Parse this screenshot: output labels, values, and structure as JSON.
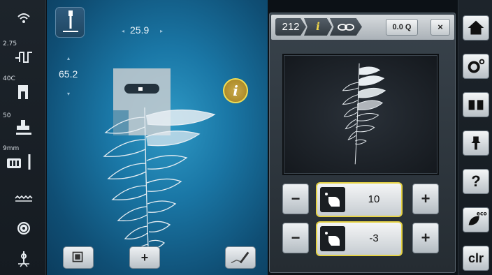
{
  "left_bar": {
    "items": [
      {
        "icon": "wifi-icon",
        "label": ""
      },
      {
        "icon": "stitch-width-icon",
        "label": "2.75"
      },
      {
        "icon": "presser-foot-icon",
        "label": "40C"
      },
      {
        "icon": "foot-pressure-icon",
        "label": "50"
      },
      {
        "icon": "needle-position-icon",
        "label": "9mm"
      },
      {
        "icon": "feed-dog-icon",
        "label": ""
      },
      {
        "icon": "bobbin-icon",
        "label": ""
      },
      {
        "icon": "thread-tension-icon",
        "label": ""
      }
    ]
  },
  "canvas": {
    "stitch_width": "25.9",
    "stitch_length": "65.2",
    "info_label": "i",
    "add_label": "+"
  },
  "panel": {
    "tabs": {
      "pattern_number": "212",
      "info": "i",
      "sequence_icon": "sequence-icon"
    },
    "zoom_label": "0.0 Q",
    "close_label": "×",
    "controls": [
      {
        "minus": "−",
        "value": "10",
        "plus": "+"
      },
      {
        "minus": "−",
        "value": "-3",
        "plus": "+"
      }
    ]
  },
  "right_bar": {
    "buttons": [
      {
        "icon": "home-icon"
      },
      {
        "icon": "setup-icon"
      },
      {
        "icon": "tutorial-icon"
      },
      {
        "icon": "creative-consultant-icon"
      },
      {
        "icon": "help-icon",
        "label": "?"
      },
      {
        "icon": "eco-icon",
        "label": "eco"
      },
      {
        "icon": "clear-icon",
        "label": "clr"
      }
    ]
  },
  "colors": {
    "accent": "#e5d246",
    "canvas": "#1a77a6"
  }
}
